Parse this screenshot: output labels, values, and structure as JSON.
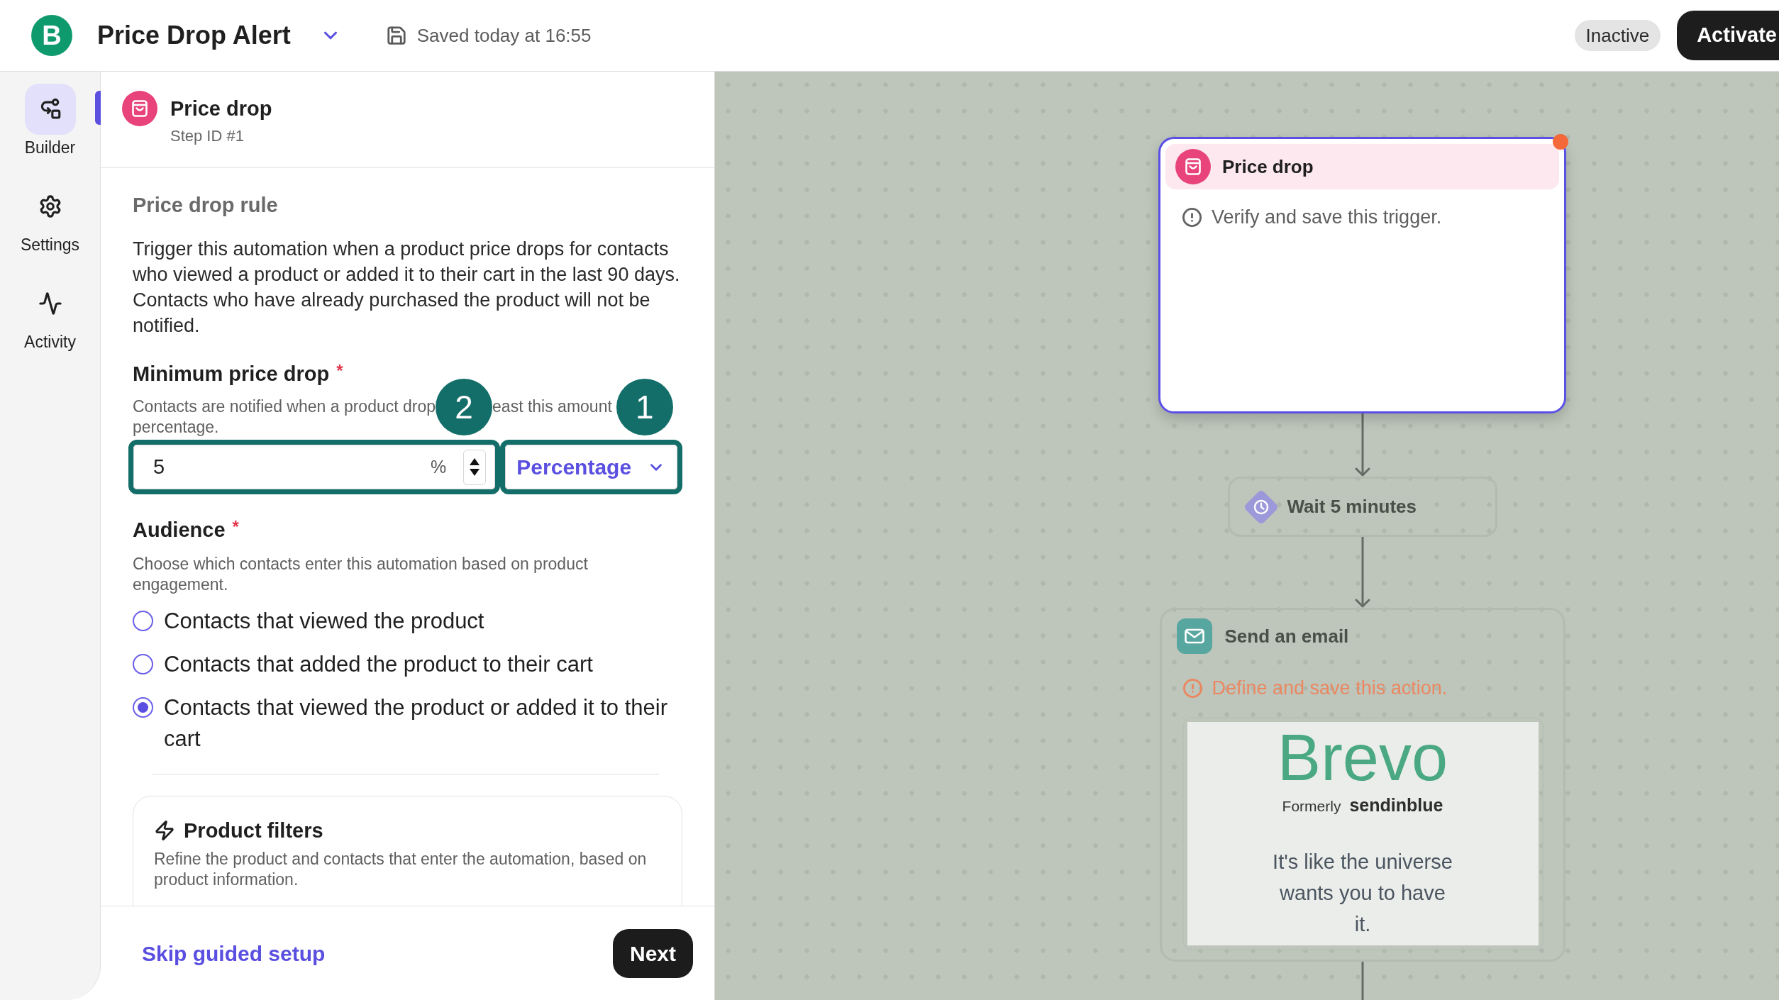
{
  "top_bar": {
    "logo": "B",
    "title": "Price Drop Alert",
    "save_status": "Saved today at 16:55",
    "status": "Inactive",
    "activate_button": "Activate"
  },
  "nav": [
    {
      "label": "Builder",
      "selected": true
    },
    {
      "label": "Settings",
      "selected": false
    },
    {
      "label": "Activity",
      "selected": false
    }
  ],
  "step_panel": {
    "title": "Price drop",
    "step_id": "Step ID #1",
    "rule": {
      "heading": "Price drop rule",
      "description": "Trigger this automation when a product price drops for contacts who viewed a product or added it to their cart in the last 90 days. Contacts who have already purchased the product will not be notified."
    },
    "minimum_price_drop": {
      "label": "Minimum price drop",
      "required_mark": "*",
      "help_visible_parts": [
        "Contacts are notified when a product drop",
        "east this amount",
        "percentage."
      ],
      "callouts": [
        "2",
        "1"
      ],
      "amount": {
        "value": "5",
        "unit": "%"
      },
      "amount_type": "Percentage"
    },
    "audience": {
      "label": "Audience",
      "required_mark": "*",
      "help": "Choose which contacts enter this automation based on product engagement.",
      "options": [
        {
          "label": "Contacts that viewed the product",
          "selected": false
        },
        {
          "label": "Contacts that added the product to their cart",
          "selected": false
        },
        {
          "label": "Contacts that viewed the product or added it to their cart",
          "selected": true
        }
      ]
    },
    "product_filters": {
      "title": "Product filters",
      "description": "Refine the product and contacts that enter the automation, based on product information."
    },
    "footer": {
      "skip_link": "Skip guided setup",
      "next_button": "Next"
    }
  },
  "canvas": {
    "nodes": [
      {
        "kind": "trigger",
        "title": "Price drop",
        "focused": true,
        "alert_dot": true,
        "message": {
          "kind": "info",
          "text": "Verify and save this trigger."
        }
      },
      {
        "kind": "delay",
        "title": "Wait 5 minutes",
        "focused": false,
        "alert_dot": false
      },
      {
        "kind": "email",
        "title": "Send an email",
        "focused": false,
        "alert_dot": false,
        "message": {
          "kind": "error",
          "text": "Define and save this action."
        },
        "preview": {
          "logo": "Brevo",
          "formerly": "Formerly",
          "former_brand": "sendinblue",
          "text_lines": [
            "It's like the universe",
            "wants you to have",
            "it."
          ]
        }
      }
    ]
  }
}
